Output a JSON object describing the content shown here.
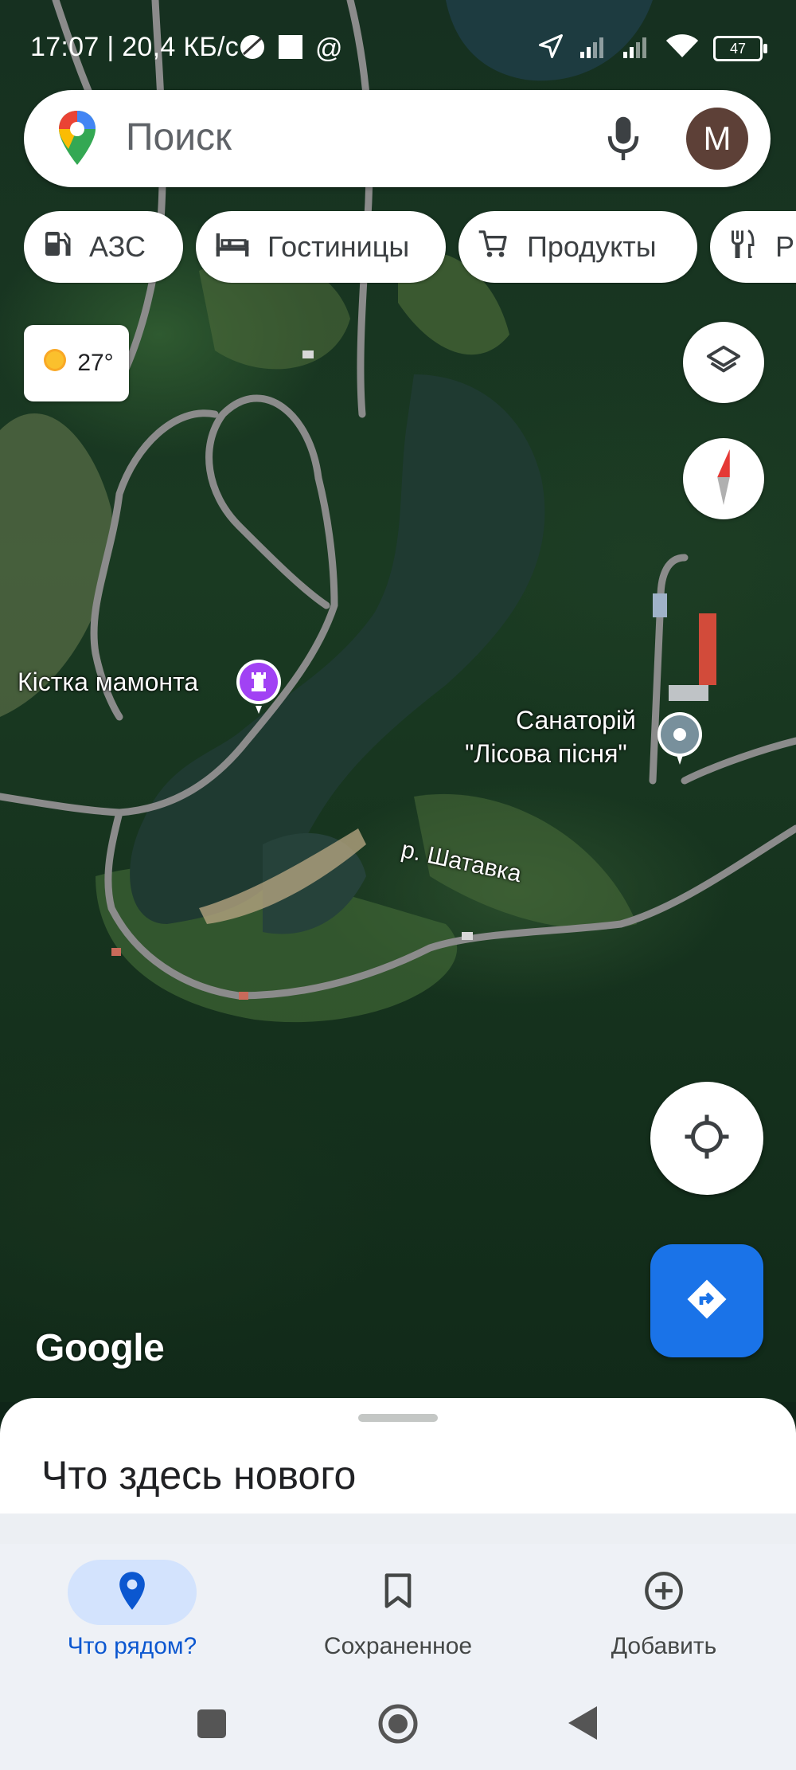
{
  "status_bar": {
    "time_speed": "17:07 | 20,4 КБ/с",
    "battery": "47"
  },
  "search": {
    "placeholder": "Поиск",
    "avatar_letter": "M"
  },
  "chips": [
    {
      "label": "АЗС",
      "icon": "gas-station-icon"
    },
    {
      "label": "Гостиницы",
      "icon": "hotel-bed-icon"
    },
    {
      "label": "Продукты",
      "icon": "shopping-cart-icon"
    },
    {
      "label": "Р",
      "icon": "restaurant-icon"
    }
  ],
  "weather": {
    "temp": "27°",
    "icon": "sun-icon"
  },
  "map": {
    "places": [
      {
        "name": "Кістка мамонта",
        "icon": "museum-icon"
      },
      {
        "name_line1": "Санаторій",
        "name_line2": "\"Лісова пісня\"",
        "icon": "place-pin-icon"
      }
    ],
    "river": "р. Шатавка",
    "attribution": "Google"
  },
  "bottom_sheet": {
    "title": "Что здесь нового"
  },
  "bottom_nav": [
    {
      "label": "Что рядом?",
      "icon": "location-pin-icon",
      "active": true
    },
    {
      "label": "Сохраненное",
      "icon": "bookmark-icon",
      "active": false
    },
    {
      "label": "Добавить",
      "icon": "add-circle-icon",
      "active": false
    }
  ],
  "colors": {
    "accent": "#1a73e8",
    "active_nav_bg": "#d3e3fd",
    "avatar": "#5d4037",
    "museum_pin": "#a142f4"
  }
}
